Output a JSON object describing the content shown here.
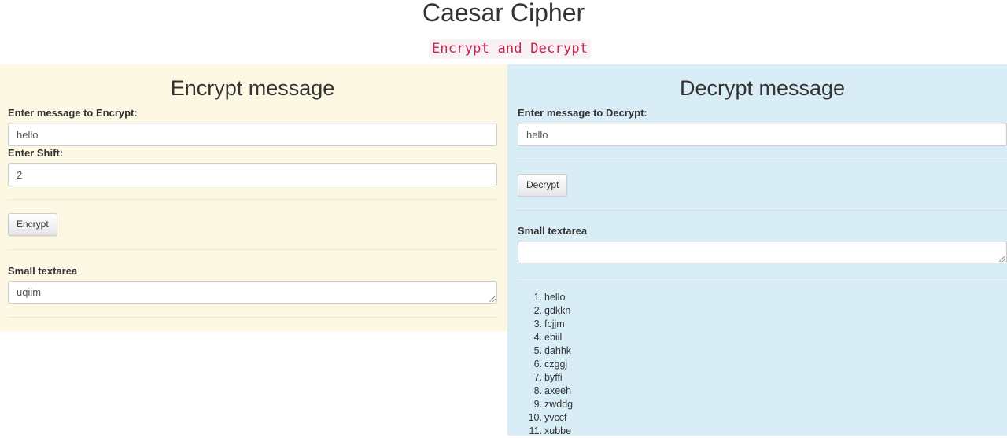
{
  "header": {
    "title": "Caesar Cipher",
    "subtitle": "Encrypt and Decrypt"
  },
  "encrypt_panel": {
    "heading": "Encrypt message",
    "message_label": "Enter message to Encrypt:",
    "message_value": "hello",
    "shift_label": "Enter Shift:",
    "shift_value": "2",
    "button_label": "Encrypt",
    "output_label": "Small textarea",
    "output_value": "uqiim"
  },
  "decrypt_panel": {
    "heading": "Decrypt message",
    "message_label": "Enter message to Decrypt:",
    "message_value": "hello",
    "button_label": "Decrypt",
    "output_label": "Small textarea",
    "output_value": "",
    "results": [
      {
        "num": "1.",
        "text": "hello"
      },
      {
        "num": "2.",
        "text": "gdkkn"
      },
      {
        "num": "3.",
        "text": "fcjjm"
      },
      {
        "num": "4.",
        "text": "ebiil"
      },
      {
        "num": "5.",
        "text": "dahhk"
      },
      {
        "num": "6.",
        "text": "czggj"
      },
      {
        "num": "7.",
        "text": "byffi"
      },
      {
        "num": "8.",
        "text": "axeeh"
      },
      {
        "num": "9.",
        "text": "zwddg"
      },
      {
        "num": "10.",
        "text": "yvccf"
      },
      {
        "num": "11.",
        "text": "xubbe"
      }
    ]
  },
  "colors": {
    "encrypt_bg": "#fcf8e3",
    "decrypt_bg": "#d9edf7",
    "code_text": "#c7254e",
    "code_bg": "#f9f2f4"
  }
}
